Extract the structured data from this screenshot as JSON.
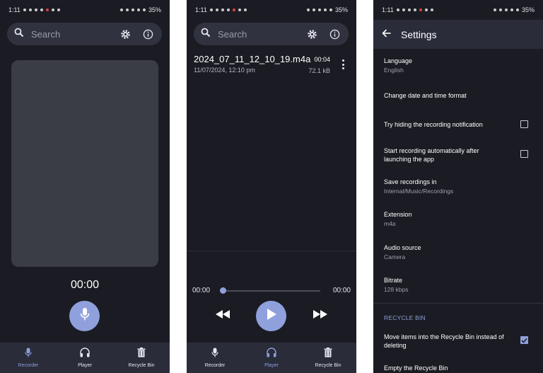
{
  "status_bar": {
    "time": "1:11",
    "battery": "35%"
  },
  "search": {
    "placeholder": "Search"
  },
  "nav": {
    "recorder": "Recorder",
    "player": "Player",
    "recycle_bin": "Recycle Bin"
  },
  "recorder": {
    "timer": "00:00"
  },
  "player": {
    "recording": {
      "name": "2024_07_11_12_10_19.m4a",
      "date": "11/07/2024, 12:10 pm",
      "duration": "00:04",
      "size": "72.1 kB"
    },
    "elapsed": "00:00",
    "total": "00:00",
    "progress": 0.0
  },
  "settings": {
    "title": "Settings",
    "items": [
      {
        "title": "Language",
        "subtitle": "English"
      },
      {
        "title": "Change date and time format",
        "subtitle": ""
      },
      {
        "title": "Try hiding the recording notification",
        "subtitle": "",
        "checked": false
      },
      {
        "title": "Start recording automatically after launching the app",
        "subtitle": "",
        "checked": false
      },
      {
        "title": "Save recordings in",
        "subtitle": "Internal/Music/Recordings"
      },
      {
        "title": "Extension",
        "subtitle": "m4a"
      },
      {
        "title": "Audio source",
        "subtitle": "Camera"
      },
      {
        "title": "Bitrate",
        "subtitle": "128 kbps"
      }
    ],
    "recycle_section": "RECYCLE BIN",
    "recycle_items": [
      {
        "title": "Move items into the Recycle Bin instead of deleting",
        "checked": true
      },
      {
        "title": "Empty the Recycle Bin"
      }
    ]
  },
  "colors": {
    "background": "#1b1c23",
    "accent": "#8fa0dc",
    "surface": "#2a2c3a"
  }
}
